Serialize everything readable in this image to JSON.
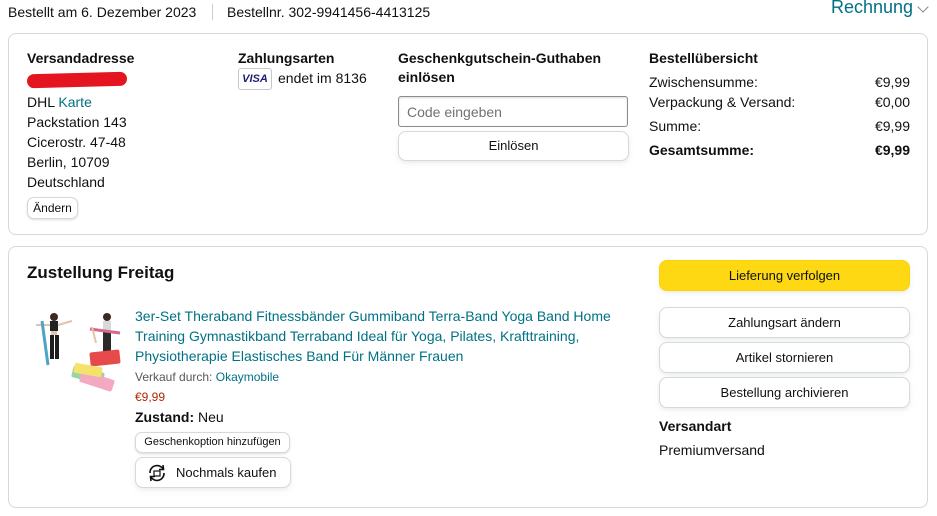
{
  "header": {
    "ordered_on": "Bestellt am 6. Dezember 2023",
    "order_number": "Bestellnr. 302-9941456-4413125",
    "invoice_label": "Rechnung"
  },
  "shipping_address": {
    "heading": "Versandadresse",
    "carrier": "DHL",
    "map_link": "Karte",
    "lines": [
      "Packstation 143",
      "Cicerostr. 47-48",
      "Berlin, 10709",
      "Deutschland"
    ],
    "change_label": "Ändern"
  },
  "payment": {
    "heading": "Zahlungsarten",
    "card_brand": "VISA",
    "card_ending": "endet im 8136"
  },
  "gift_card": {
    "heading_line1": "Geschenkgutschein-Guthaben",
    "heading_line2": "einlösen",
    "placeholder": "Code eingeben",
    "redeem_label": "Einlösen"
  },
  "order_summary": {
    "heading": "Bestellübersicht",
    "rows": [
      {
        "label": "Zwischensumme:",
        "value": "€9,99"
      },
      {
        "label": "Verpackung & Versand:",
        "value": "€0,00"
      },
      {
        "label": "Summe:",
        "value": "€9,99"
      }
    ],
    "total": {
      "label": "Gesamtsumme:",
      "value": "€9,99"
    }
  },
  "delivery": {
    "heading": "Zustellung Freitag",
    "product": {
      "title_lines": [
        "3er-Set Theraband Fitnessbänder Gummiband Terra-Band Yoga Band Home",
        "Training Gymnastikband Terraband Ideal für Yoga, Pilates, Krafttraining,",
        "Physiotherapie Elastisches Band Für Männer Frauen"
      ],
      "sold_by_label": "Verkauf durch:",
      "seller": "Okaymobile",
      "price": "€9,99",
      "condition_label": "Zustand:",
      "condition_value": "Neu",
      "gift_option_label": "Geschenkoption hinzufügen",
      "buy_again_label": "Nochmals kaufen"
    },
    "actions": {
      "track": "Lieferung verfolgen",
      "change_payment": "Zahlungsart ändern",
      "cancel": "Artikel stornieren",
      "archive": "Bestellung archivieren"
    },
    "shipping_method_heading": "Versandart",
    "shipping_method": "Premiumversand"
  },
  "colors": {
    "link": "#007185",
    "price": "#b12704",
    "primary_button": "#ffd814",
    "redaction": "#e4151f"
  }
}
